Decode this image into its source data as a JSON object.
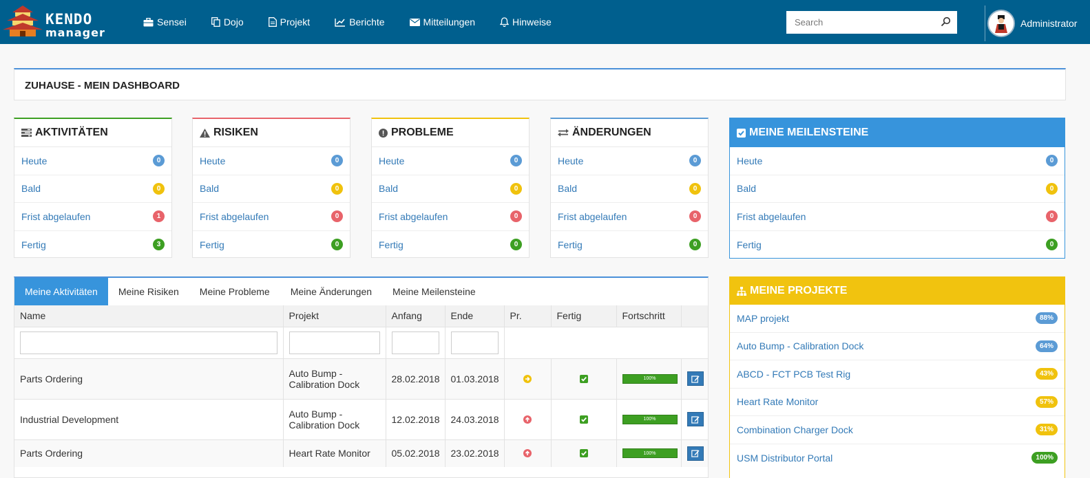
{
  "brand": {
    "line1": "KENDO",
    "line2": "manager"
  },
  "nav": [
    {
      "label": "Sensei",
      "icon": "briefcase-icon"
    },
    {
      "label": "Dojo",
      "icon": "copy-icon"
    },
    {
      "label": "Projekt",
      "icon": "file-icon"
    },
    {
      "label": "Berichte",
      "icon": "line-chart-icon"
    },
    {
      "label": "Mitteilungen",
      "icon": "envelope-icon"
    },
    {
      "label": "Hinweise",
      "icon": "bell-icon"
    }
  ],
  "search": {
    "placeholder": "Search"
  },
  "user": {
    "name": "Administrator"
  },
  "page": {
    "title": "ZUHAUSE - MEIN DASHBOARD"
  },
  "boxes": [
    {
      "title": "AKTIVITÄTEN",
      "icon": "tasks-icon",
      "accent": "#3d9f22",
      "rows": [
        {
          "label": "Heute",
          "count": "0"
        },
        {
          "label": "Bald",
          "count": "0"
        },
        {
          "label": "Frist abgelaufen",
          "count": "1"
        },
        {
          "label": "Fertig",
          "count": "3"
        }
      ]
    },
    {
      "title": "RISIKEN",
      "icon": "warning-icon",
      "accent": "#e8636a",
      "rows": [
        {
          "label": "Heute",
          "count": "0"
        },
        {
          "label": "Bald",
          "count": "0"
        },
        {
          "label": "Frist abgelaufen",
          "count": "0"
        },
        {
          "label": "Fertig",
          "count": "0"
        }
      ]
    },
    {
      "title": "PROBLEME",
      "icon": "exclamation-circle-icon",
      "accent": "#f0c20d",
      "rows": [
        {
          "label": "Heute",
          "count": "0"
        },
        {
          "label": "Bald",
          "count": "0"
        },
        {
          "label": "Frist abgelaufen",
          "count": "0"
        },
        {
          "label": "Fertig",
          "count": "0"
        }
      ]
    },
    {
      "title": "ÄNDERUNGEN",
      "icon": "exchange-icon",
      "accent": "#5b9bd5",
      "rows": [
        {
          "label": "Heute",
          "count": "0"
        },
        {
          "label": "Bald",
          "count": "0"
        },
        {
          "label": "Frist abgelaufen",
          "count": "0"
        },
        {
          "label": "Fertig",
          "count": "0"
        }
      ]
    }
  ],
  "milestones": {
    "title": "MEINE MEILENSTEINE",
    "icon": "check-square-icon",
    "rows": [
      {
        "label": "Heute",
        "count": "0"
      },
      {
        "label": "Bald",
        "count": "0"
      },
      {
        "label": "Frist abgelaufen",
        "count": "0"
      },
      {
        "label": "Fertig",
        "count": "0"
      }
    ]
  },
  "projects": {
    "title": "MEINE PROJEKTE",
    "icon": "sitemap-icon",
    "items": [
      {
        "name": "MAP projekt",
        "pct": "88%",
        "color": "#5b9bd5"
      },
      {
        "name": "Auto Bump - Calibration Dock",
        "pct": "64%",
        "color": "#5b9bd5"
      },
      {
        "name": "ABCD - FCT PCB Test Rig",
        "pct": "43%",
        "color": "#f0c20d"
      },
      {
        "name": "Heart Rate Monitor",
        "pct": "57%",
        "color": "#f0c20d"
      },
      {
        "name": "Combination Charger Dock",
        "pct": "31%",
        "color": "#f0c20d"
      },
      {
        "name": "USM Distributor Portal",
        "pct": "100%",
        "color": "#3d9f22"
      }
    ]
  },
  "tabs": [
    "Meine Aktivitäten",
    "Meine Risiken",
    "Meine Probleme",
    "Meine Änderungen",
    "Meine Meilensteine"
  ],
  "table": {
    "columns": [
      "Name",
      "Projekt",
      "Anfang",
      "Ende",
      "Pr.",
      "Fertig",
      "Fortschritt",
      ""
    ],
    "rows": [
      {
        "name": "Parts Ordering",
        "project": "Auto Bump - Calibration Dock",
        "start": "28.02.2018",
        "end": "01.03.2018",
        "priority": "normal",
        "priority_icon": "arrow-circle-right-icon",
        "done": true,
        "progress": "100%"
      },
      {
        "name": "Industrial Development",
        "project": "Auto Bump - Calibration Dock",
        "start": "12.02.2018",
        "end": "24.03.2018",
        "priority": "high",
        "priority_icon": "arrow-circle-up-icon",
        "done": true,
        "progress": "100%"
      },
      {
        "name": "Parts Ordering",
        "project": "Heart Rate Monitor",
        "start": "05.02.2018",
        "end": "23.02.2018",
        "priority": "high",
        "priority_icon": "arrow-circle-up-icon",
        "done": true,
        "progress": "100%"
      }
    ]
  }
}
